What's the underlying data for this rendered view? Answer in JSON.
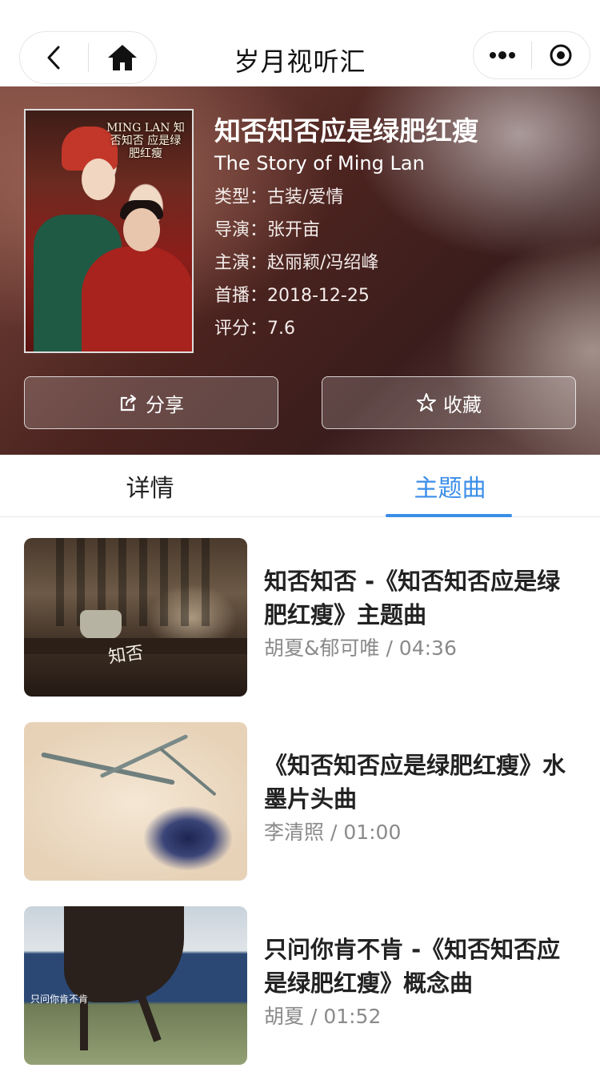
{
  "nav": {
    "title": "岁月视听汇",
    "icons": [
      "back-icon",
      "home-icon",
      "more-icon",
      "record-icon"
    ]
  },
  "movie": {
    "title": "知否知否应是绿肥红瘦",
    "english_title": "The Story of Ming Lan",
    "genre": "类型：古装/爱情",
    "director": "导演：张开亩",
    "cast": "主演：赵丽颖/冯绍峰",
    "premiere": "首播：2018-12-25",
    "rating": "评分：7.6",
    "poster_logo": "MING LAN 知否知否 应是绿肥红瘦"
  },
  "actions": {
    "share_label": "分享",
    "favorite_label": "收藏"
  },
  "tabs": {
    "detail_label": "详情",
    "theme_label": "主题曲",
    "active": "主题曲"
  },
  "songs": [
    {
      "title": "知否知否 -《知否知否应是绿肥红瘦》主题曲",
      "meta": "胡夏&郁可唯 / 04:36",
      "thumb_text": "知否"
    },
    {
      "title": "《知否知否应是绿肥红瘦》水墨片头曲",
      "meta": "李清照 / 01:00"
    },
    {
      "title": "只问你肯不肯 -《知否知否应是绿肥红瘦》概念曲",
      "meta": "胡夏 / 01:52",
      "thumb_text": "只问你肯不肯"
    }
  ],
  "colors": {
    "accent": "#3b8ee8",
    "title_text": "#222222",
    "meta_text": "#8a8a8a"
  }
}
